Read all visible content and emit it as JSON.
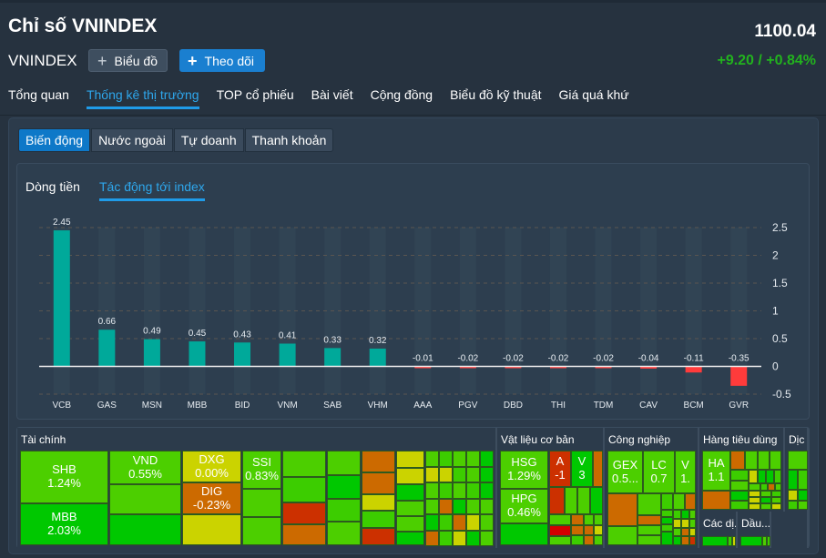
{
  "header": {
    "title": "Chỉ số VNINDEX",
    "symbol": "VNINDEX",
    "price": "1100.04",
    "change": "+9.20 / +0.84%",
    "buttons": {
      "chart": "Biểu đồ",
      "follow": "Theo dõi"
    },
    "icons": {
      "chart": "plus-icon",
      "follow": "plus-icon"
    }
  },
  "nav": {
    "tabs": [
      {
        "label": "Tổng quan",
        "active": false
      },
      {
        "label": "Thống kê thị trường",
        "active": true
      },
      {
        "label": "TOP cổ phiếu",
        "active": false
      },
      {
        "label": "Bài viết",
        "active": false
      },
      {
        "label": "Cộng đồng",
        "active": false
      },
      {
        "label": "Biểu đồ kỹ thuật",
        "active": false
      },
      {
        "label": "Giá quá khứ",
        "active": false
      }
    ]
  },
  "segment": {
    "items": [
      {
        "label": "Biến động",
        "active": true
      },
      {
        "label": "Nước ngoài",
        "active": false
      },
      {
        "label": "Tự doanh",
        "active": false
      },
      {
        "label": "Thanh khoản",
        "active": false
      }
    ]
  },
  "subtabs": {
    "items": [
      {
        "label": "Dòng tiền",
        "active": false
      },
      {
        "label": "Tác động tới index",
        "active": true
      }
    ]
  },
  "colors": {
    "positive": "#00a99a",
    "negative": "#ff3b3b",
    "accent": "#1f9be8",
    "up_text": "#22b21e"
  },
  "chart_data": {
    "type": "bar",
    "title": "Tác động tới index",
    "categories": [
      "VCB",
      "GAS",
      "MSN",
      "MBB",
      "BID",
      "VNM",
      "SAB",
      "VHM",
      "AAA",
      "PGV",
      "DBD",
      "THI",
      "TDM",
      "CAV",
      "BCM",
      "GVR"
    ],
    "values": [
      2.45,
      0.66,
      0.49,
      0.45,
      0.43,
      0.41,
      0.33,
      0.32,
      -0.01,
      -0.02,
      -0.02,
      -0.02,
      -0.02,
      -0.04,
      -0.11,
      -0.35
    ],
    "labels": [
      "2.45",
      "0.66",
      "0.49",
      "0.45",
      "0.43",
      "0.41",
      "0.33",
      "0.32",
      "-0.01",
      "-0.02",
      "-0.02",
      "-0.02",
      "-0.02",
      "-0.04",
      "-0.11",
      "-0.35"
    ],
    "yticks": [
      "2.5",
      "2",
      "1.5",
      "1",
      "0.5",
      "0",
      "-0.5"
    ],
    "ytick_values": [
      2.5,
      2,
      1.5,
      1,
      0.5,
      0,
      -0.5
    ],
    "ylim": [
      -0.5,
      2.5
    ],
    "xlabel": "",
    "ylabel": "",
    "grid": true,
    "y_axis_side": "right"
  },
  "treemap": {
    "sectors": [
      {
        "name": "Tài chính"
      },
      {
        "name": "Vật liệu cơ bản"
      },
      {
        "name": "Công nghiệp"
      },
      {
        "name": "Hàng tiêu dùng"
      },
      {
        "name": "Dịc"
      },
      {
        "name": "Các dị..."
      },
      {
        "name": "Dầu..."
      }
    ],
    "labeled_cells": [
      {
        "ticker": "SHB",
        "change": "1.24%"
      },
      {
        "ticker": "MBB",
        "change": "2.03%"
      },
      {
        "ticker": "VND",
        "change": "0.55%"
      },
      {
        "ticker": "DXG",
        "change": "0.00%"
      },
      {
        "ticker": "DIG",
        "change": "-0.23%"
      },
      {
        "ticker": "SSI",
        "change": "0.83%"
      },
      {
        "ticker": "HSG",
        "change": "1.29%"
      },
      {
        "ticker": "HPG",
        "change": "0.46%"
      },
      {
        "ticker": "A",
        "change": "-1"
      },
      {
        "ticker": "V",
        "change": "3"
      },
      {
        "ticker": "GEX",
        "change": "0.5..."
      },
      {
        "ticker": "LC",
        "change": "0.7"
      },
      {
        "ticker": "V",
        "change": "1."
      },
      {
        "ticker": "HA",
        "change": "1.1"
      }
    ]
  }
}
